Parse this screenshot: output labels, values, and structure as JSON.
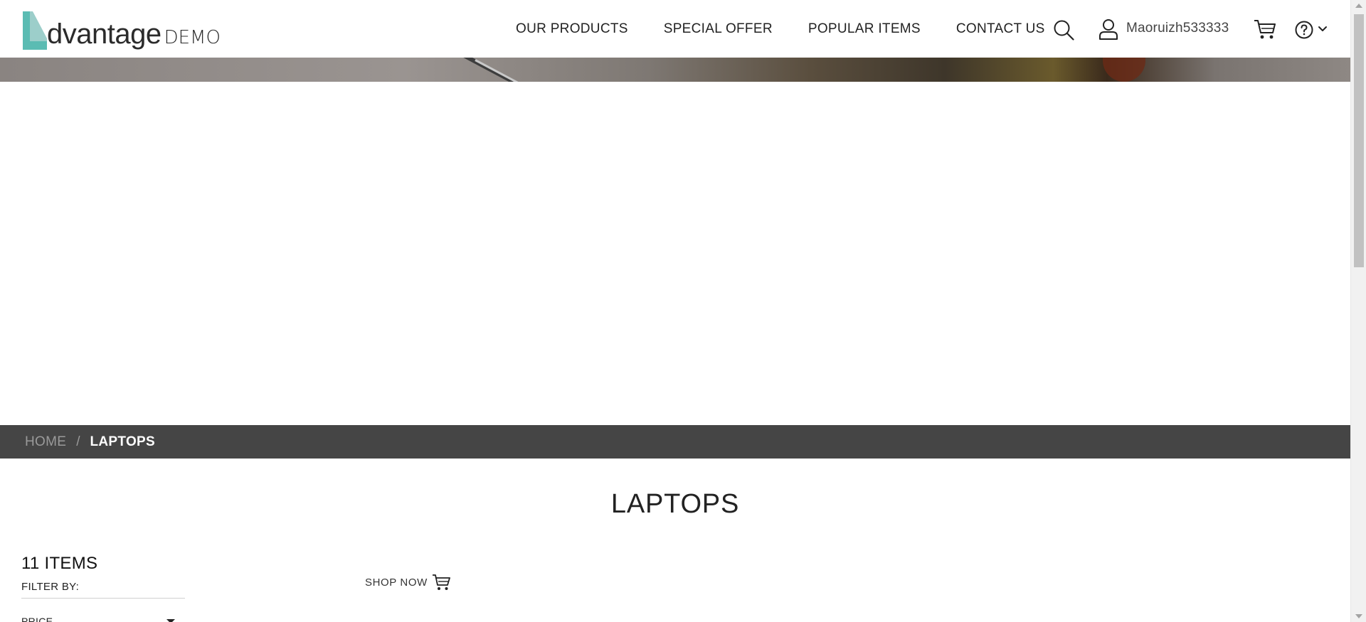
{
  "brand": {
    "logo_text": "dvantage",
    "logo_suffix": "DEMO",
    "accent_color": "#5bbcb3"
  },
  "nav": {
    "items": [
      {
        "label": "OUR PRODUCTS"
      },
      {
        "label": "SPECIAL OFFER"
      },
      {
        "label": "POPULAR ITEMS"
      },
      {
        "label": "CONTACT US"
      }
    ]
  },
  "header_icons": {
    "search": "search-icon",
    "user": "user-icon",
    "cart": "cart-icon",
    "help": "help-icon",
    "dropdown": "chevron-down-icon"
  },
  "user": {
    "username": "Maoruizh533333"
  },
  "breadcrumb": {
    "home": "HOME",
    "separator": "/",
    "current": "LAPTOPS"
  },
  "page": {
    "title": "LAPTOPS"
  },
  "filters": {
    "items_count": "11 ITEMS",
    "filter_by": "FILTER BY:",
    "price_label": "PRICE"
  },
  "shop_now": {
    "label": "SHOP NOW"
  }
}
